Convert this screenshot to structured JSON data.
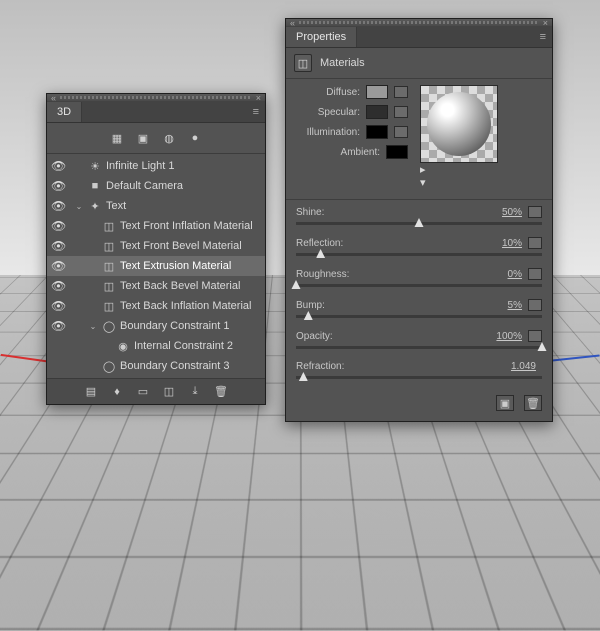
{
  "panel3d": {
    "title": "3D",
    "filters": [
      "scene-filter-icon",
      "mesh-filter-icon",
      "materials-filter-icon",
      "lights-filter-icon"
    ],
    "items": [
      {
        "eye": true,
        "depth": 1,
        "caret": "",
        "icon": "sun-icon",
        "label": "Infinite Light 1",
        "sel": false
      },
      {
        "eye": true,
        "depth": 1,
        "caret": "",
        "icon": "camera-icon",
        "label": "Default Camera",
        "sel": false
      },
      {
        "eye": true,
        "depth": 1,
        "caret": "v",
        "icon": "mesh-icon",
        "label": "Text",
        "sel": false
      },
      {
        "eye": true,
        "depth": 2,
        "caret": "",
        "icon": "material-icon",
        "label": "Text Front Inflation Material",
        "sel": false
      },
      {
        "eye": true,
        "depth": 2,
        "caret": "",
        "icon": "material-icon",
        "label": "Text Front Bevel Material",
        "sel": false
      },
      {
        "eye": true,
        "depth": 2,
        "caret": "",
        "icon": "material-icon",
        "label": "Text Extrusion Material",
        "sel": true
      },
      {
        "eye": true,
        "depth": 2,
        "caret": "",
        "icon": "material-icon",
        "label": "Text Back Bevel Material",
        "sel": false
      },
      {
        "eye": true,
        "depth": 2,
        "caret": "",
        "icon": "material-icon",
        "label": "Text Back Inflation Material",
        "sel": false
      },
      {
        "eye": true,
        "depth": 2,
        "caret": "v",
        "icon": "circle-icon",
        "label": "Boundary Constraint 1",
        "sel": false
      },
      {
        "eye": false,
        "depth": 3,
        "caret": "",
        "icon": "dot-icon",
        "label": "Internal Constraint 2",
        "sel": false
      },
      {
        "eye": false,
        "depth": 2,
        "caret": "",
        "icon": "circle-icon",
        "label": "Boundary Constraint 3",
        "sel": false
      }
    ],
    "footer_icons": [
      "layers-icon",
      "light-icon",
      "camera-icon",
      "texture-icon",
      "export-icon",
      "trash-icon"
    ]
  },
  "panelProps": {
    "title": "Properties",
    "section_title": "Materials",
    "swatches": {
      "diffuse": {
        "label": "Diffuse:",
        "color": "#9a9a9a"
      },
      "specular": {
        "label": "Specular:",
        "color": "#2e2e2e"
      },
      "illumination": {
        "label": "Illumination:",
        "color": "#000000"
      },
      "ambient": {
        "label": "Ambient:",
        "color": "#000000"
      }
    },
    "sliders": {
      "shine": {
        "label": "Shine:",
        "value": "50%",
        "pct": 50,
        "folder": true
      },
      "reflection": {
        "label": "Reflection:",
        "value": "10%",
        "pct": 10,
        "folder": true
      },
      "roughness": {
        "label": "Roughness:",
        "value": "0%",
        "pct": 0,
        "folder": true
      },
      "bump": {
        "label": "Bump:",
        "value": "5%",
        "pct": 5,
        "folder": true
      },
      "opacity": {
        "label": "Opacity:",
        "value": "100%",
        "pct": 100,
        "folder": true
      },
      "refraction": {
        "label": "Refraction:",
        "value": "1.049",
        "pct": 3,
        "folder": false
      }
    }
  }
}
